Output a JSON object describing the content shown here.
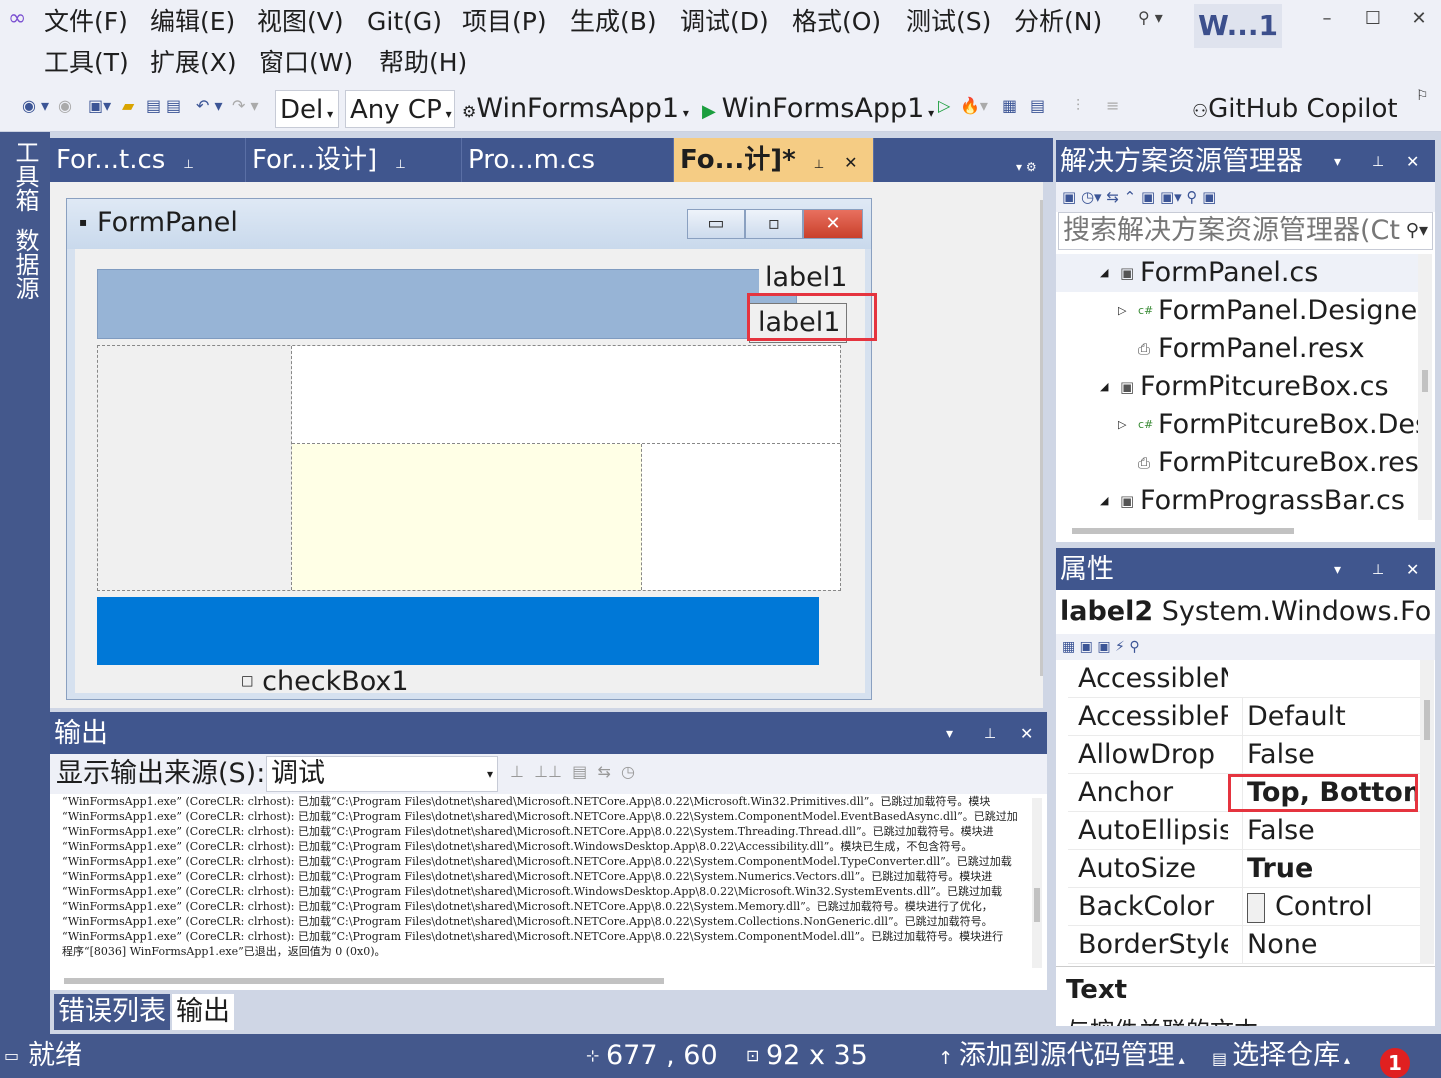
{
  "menus": {
    "row1": [
      "文件(F)",
      "编辑(E)",
      "视图(V)",
      "Git(G)",
      "项目(P)",
      "生成(B)",
      "调试(D)",
      "格式(O)",
      "测试(S)",
      "分析(N)"
    ],
    "row2": [
      "工具(T)",
      "扩展(X)",
      "窗口(W)",
      "帮助(H)"
    ]
  },
  "title_tab": "W...1",
  "toolbar": {
    "config": "Del",
    "platform": "Any CP",
    "startup_project": "WinFormsApp1",
    "run_target": "WinFormsApp1",
    "copilot": "GitHub Copilot"
  },
  "left_strip": [
    "工具箱",
    "数据源"
  ],
  "doc_tabs": [
    {
      "label": "For...t.cs",
      "active": false
    },
    {
      "label": "For...设计]",
      "active": false
    },
    {
      "label": "Pro...m.cs",
      "active": false
    },
    {
      "label": "Fo...计]*",
      "active": true
    }
  ],
  "form": {
    "caption": "FormPanel",
    "label1_top": "label1",
    "label1_selected": "label1",
    "checkbox": "checkBox1"
  },
  "output": {
    "title": "输出",
    "source_label": "显示输出来源(S):",
    "source_value": "调试",
    "lines": [
      "“WinFormsApp1.exe” (CoreCLR: clrhost): 已加载“C:\\Program Files\\dotnet\\shared\\Microsoft.NETCore.App\\8.0.22\\Microsoft.Win32.Primitives.dll”。已跳过加载符号。模块",
      "“WinFormsApp1.exe” (CoreCLR: clrhost): 已加载“C:\\Program Files\\dotnet\\shared\\Microsoft.NETCore.App\\8.0.22\\System.ComponentModel.EventBasedAsync.dll”。已跳过加",
      "“WinFormsApp1.exe” (CoreCLR: clrhost): 已加载“C:\\Program Files\\dotnet\\shared\\Microsoft.NETCore.App\\8.0.22\\System.Threading.Thread.dll”。已跳过加载符号。模块进",
      "“WinFormsApp1.exe” (CoreCLR: clrhost): 已加载“C:\\Program Files\\dotnet\\shared\\Microsoft.WindowsDesktop.App\\8.0.22\\Accessibility.dll”。模块已生成，不包含符号。",
      "“WinFormsApp1.exe” (CoreCLR: clrhost): 已加载“C:\\Program Files\\dotnet\\shared\\Microsoft.NETCore.App\\8.0.22\\System.ComponentModel.TypeConverter.dll”。已跳过加载",
      "“WinFormsApp1.exe” (CoreCLR: clrhost): 已加载“C:\\Program Files\\dotnet\\shared\\Microsoft.NETCore.App\\8.0.22\\System.Numerics.Vectors.dll”。已跳过加载符号。模块进",
      "“WinFormsApp1.exe” (CoreCLR: clrhost): 已加载“C:\\Program Files\\dotnet\\shared\\Microsoft.WindowsDesktop.App\\8.0.22\\Microsoft.Win32.SystemEvents.dll”。已跳过加载",
      "“WinFormsApp1.exe” (CoreCLR: clrhost): 已加载“C:\\Program Files\\dotnet\\shared\\Microsoft.NETCore.App\\8.0.22\\System.Memory.dll”。已跳过加载符号。模块进行了优化，",
      "“WinFormsApp1.exe” (CoreCLR: clrhost): 已加载“C:\\Program Files\\dotnet\\shared\\Microsoft.NETCore.App\\8.0.22\\System.Collections.NonGeneric.dll”。已跳过加载符号。",
      "“WinFormsApp1.exe” (CoreCLR: clrhost): 已加载“C:\\Program Files\\dotnet\\shared\\Microsoft.NETCore.App\\8.0.22\\System.ComponentModel.dll”。已跳过加载符号。模块进行",
      "程序“[8036] WinFormsApp1.exe”已退出，返回值为 0 (0x0)。"
    ],
    "bottom_tabs": [
      "错误列表",
      "输出"
    ]
  },
  "solution": {
    "title": "解决方案资源管理器",
    "search_placeholder": "搜索解决方案资源管理器(Ct",
    "items": [
      {
        "label": "FormPanel.cs",
        "level": 0,
        "expander": "◢",
        "icon": "form"
      },
      {
        "label": "FormPanel.Designer",
        "level": 1,
        "expander": "▷",
        "icon": "cs"
      },
      {
        "label": "FormPanel.resx",
        "level": 1,
        "expander": "",
        "icon": "resx"
      },
      {
        "label": "FormPitcureBox.cs",
        "level": 0,
        "expander": "◢",
        "icon": "form"
      },
      {
        "label": "FormPitcureBox.Des",
        "level": 1,
        "expander": "▷",
        "icon": "cs"
      },
      {
        "label": "FormPitcureBox.resx",
        "level": 1,
        "expander": "",
        "icon": "resx"
      },
      {
        "label": "FormPrograssBar.cs",
        "level": 0,
        "expander": "◢",
        "icon": "form"
      }
    ]
  },
  "properties": {
    "title": "属性",
    "object_name": "label2",
    "object_type": "System.Windows.For",
    "rows": [
      {
        "name": "AccessibleN",
        "value": "",
        "bold": false
      },
      {
        "name": "AccessibleR",
        "value": "Default",
        "bold": false
      },
      {
        "name": "AllowDrop",
        "value": "False",
        "bold": false
      },
      {
        "name": "Anchor",
        "value": "Top, Bottom",
        "bold": true
      },
      {
        "name": "AutoEllipsis",
        "value": "False",
        "bold": false
      },
      {
        "name": "AutoSize",
        "value": "True",
        "bold": true
      },
      {
        "name": "BackColor",
        "value": "Control",
        "bold": false
      },
      {
        "name": "BorderStyle",
        "value": "None",
        "bold": false
      }
    ],
    "desc_title": "Text",
    "desc_text": "与控件关联的文本"
  },
  "status": {
    "ready": "就绪",
    "position": "677 , 60",
    "size": "92 x 35",
    "add_source": "添加到源代码管理",
    "select_repo": "选择仓库",
    "notifications": "1"
  },
  "colors": {
    "accent": "#40568e",
    "highlight": "#e5343f",
    "panel_blue": "#0078d7",
    "panel_gray": "#97b4d6"
  }
}
